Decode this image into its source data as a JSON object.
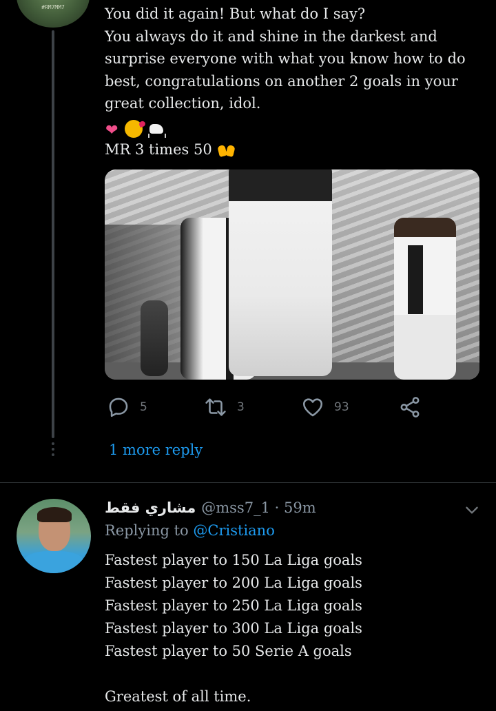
{
  "first_tweet": {
    "avatar_tag": "#RM7MM7",
    "text": "You did it again! But what do I say?\nYou always do it and shine in the darkest and surprise everyone with what you know how to do best, congratulations on another 2 goals in your great collection, idol.",
    "emojis": [
      "heart-emoji",
      "kissing-face-emoji",
      "goat-emoji"
    ],
    "mr_line": "MR 3 times 50",
    "mr_emoji": "raising-hands-emoji",
    "photo_description_icon": "photo",
    "actions": {
      "reply_count": "5",
      "retweet_count": "3",
      "like_count": "93"
    },
    "more_reply_label": "1 more reply"
  },
  "second_tweet": {
    "display_name": "مشاري فقط",
    "handle": "@mss7_1",
    "separator": "·",
    "time": "59m",
    "replying_prefix": "Replying to",
    "replying_to": "@Cristiano",
    "text": "Fastest player to 150 La Liga goals\nFastest player to 200 La Liga goals\nFastest player to 250 La Liga goals\nFastest player to 300 La Liga goals\nFastest player to 50 Serie A goals\n\nGreatest of all time."
  },
  "colors": {
    "background": "#000000",
    "text": "#e7e9ea",
    "muted": "#71767b",
    "accent": "#1d9bf0",
    "thread_line": "#3d4247"
  }
}
